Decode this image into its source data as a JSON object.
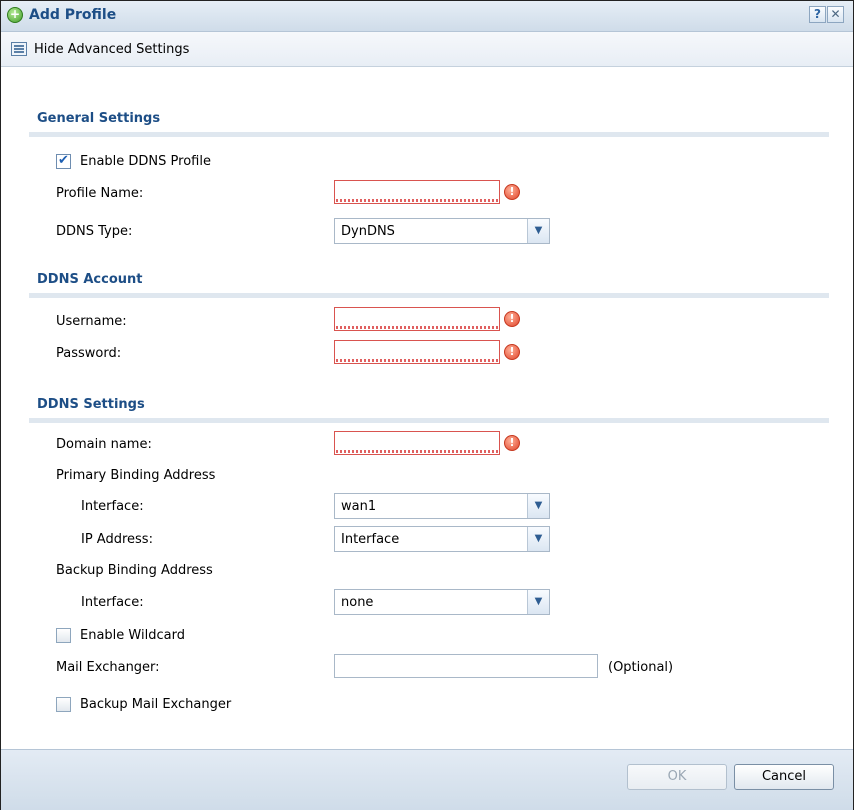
{
  "dialog": {
    "title": "Add Profile",
    "help_glyph": "?",
    "close_glyph": "✕"
  },
  "toolbar": {
    "toggle_advanced_label": "Hide Advanced Settings"
  },
  "general": {
    "title": "General Settings",
    "enable_label": "Enable DDNS Profile",
    "enable_checked": true,
    "profile_name_label": "Profile Name:",
    "profile_name_value": "",
    "ddns_type_label": "DDNS Type:",
    "ddns_type_value": "DynDNS"
  },
  "account": {
    "title": "DDNS Account",
    "username_label": "Username:",
    "username_value": "",
    "password_label": "Password:",
    "password_value": ""
  },
  "settings": {
    "title": "DDNS Settings",
    "domain_label": "Domain name:",
    "domain_value": "",
    "primary_binding_label": "Primary Binding Address",
    "primary_interface_label": "Interface:",
    "primary_interface_value": "wan1",
    "primary_ip_label": "IP Address:",
    "primary_ip_value": "Interface",
    "backup_binding_label": "Backup Binding Address",
    "backup_interface_label": "Interface:",
    "backup_interface_value": "none",
    "wildcard_label": "Enable Wildcard",
    "wildcard_checked": false,
    "mail_exchanger_label": "Mail Exchanger:",
    "mail_exchanger_value": "",
    "mail_exchanger_hint": "(Optional)",
    "backup_mail_label": "Backup Mail Exchanger",
    "backup_mail_checked": false
  },
  "footer": {
    "ok_label": "OK",
    "cancel_label": "Cancel"
  },
  "icons": {
    "error_glyph": "!",
    "dropdown_glyph": "▼",
    "add_glyph": "+"
  }
}
